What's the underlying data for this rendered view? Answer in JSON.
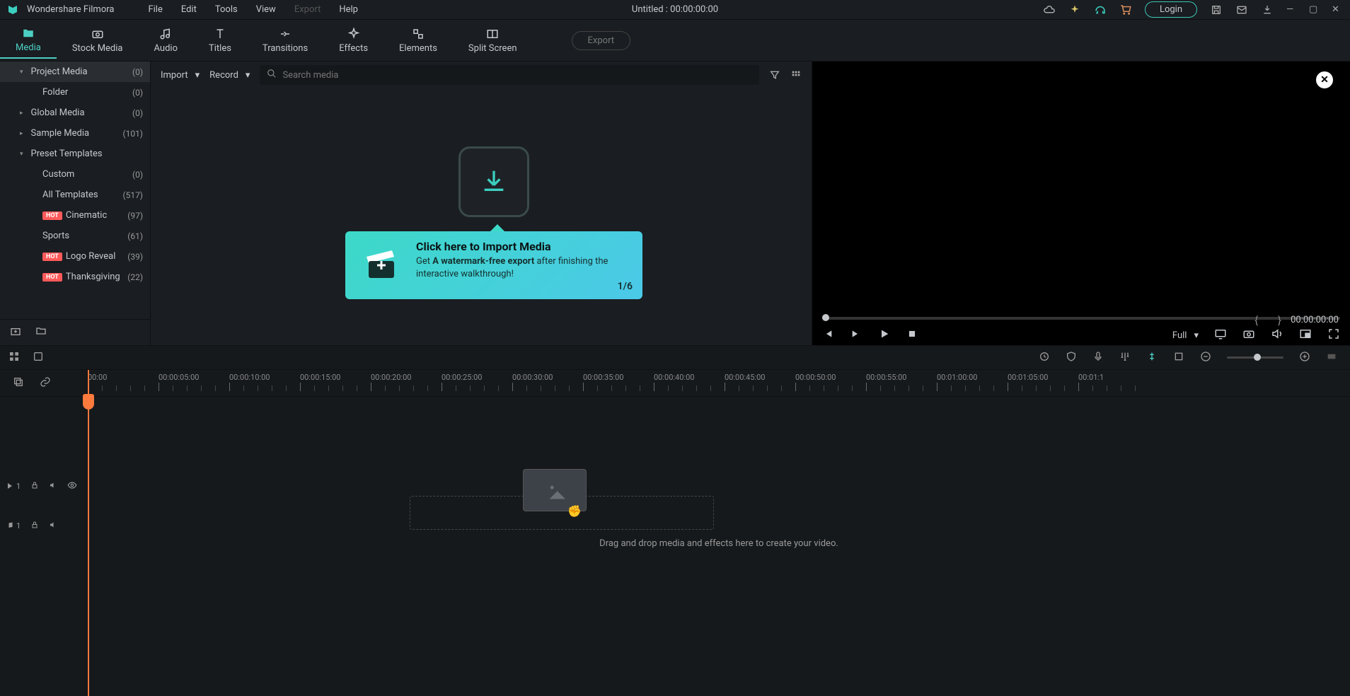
{
  "app": {
    "name": "Wondershare Filmora"
  },
  "menu": [
    "File",
    "Edit",
    "Tools",
    "View",
    "Export",
    "Help"
  ],
  "title_center": "Untitled : 00:00:00:00",
  "login": "Login",
  "tabs": [
    {
      "label": "Media"
    },
    {
      "label": "Stock Media"
    },
    {
      "label": "Audio"
    },
    {
      "label": "Titles"
    },
    {
      "label": "Transitions"
    },
    {
      "label": "Effects"
    },
    {
      "label": "Elements"
    },
    {
      "label": "Split Screen"
    }
  ],
  "export_btn": "Export",
  "media_toolbar": {
    "import": "Import",
    "record": "Record",
    "search_ph": "Search media"
  },
  "sidebar_items": [
    {
      "label": "Project Media",
      "count": "(0)",
      "caret": "▾",
      "sel": true
    },
    {
      "label": "Folder",
      "count": "(0)",
      "indent": true
    },
    {
      "label": "Global Media",
      "count": "(0)",
      "caret": "▸"
    },
    {
      "label": "Sample Media",
      "count": "(101)",
      "caret": "▸"
    },
    {
      "label": "Preset Templates",
      "count": "",
      "caret": "▾"
    },
    {
      "label": "Custom",
      "count": "(0)",
      "indent": true
    },
    {
      "label": "All Templates",
      "count": "(517)",
      "indent": true
    },
    {
      "label": "Cinematic",
      "count": "(97)",
      "indent": true,
      "hot": true
    },
    {
      "label": "Sports",
      "count": "(61)",
      "indent": true
    },
    {
      "label": "Logo Reveal",
      "count": "(39)",
      "indent": true,
      "hot": true
    },
    {
      "label": "Thanksgiving",
      "count": "(22)",
      "indent": true,
      "hot": true
    }
  ],
  "hot": "HOT",
  "tooltip": {
    "title": "Click here to Import Media",
    "body_pre": "Get ",
    "body_bold": "A watermark-free export",
    "body_post": " after finishing the interactive walkthrough!",
    "step": "1/6"
  },
  "preview": {
    "time": "00:00:00:00",
    "quality": "Full"
  },
  "ruler_marks": [
    "00:00",
    "00:00:05:00",
    "00:00:10:00",
    "00:00:15:00",
    "00:00:20:00",
    "00:00:25:00",
    "00:00:30:00",
    "00:00:35:00",
    "00:00:40:00",
    "00:00:45:00",
    "00:00:50:00",
    "00:00:55:00",
    "00:01:00:00",
    "00:01:05:00",
    "00:01:1"
  ],
  "track_video": "1",
  "track_audio": "1",
  "dropzone_label": "Drag and drop media and effects here to create your video."
}
